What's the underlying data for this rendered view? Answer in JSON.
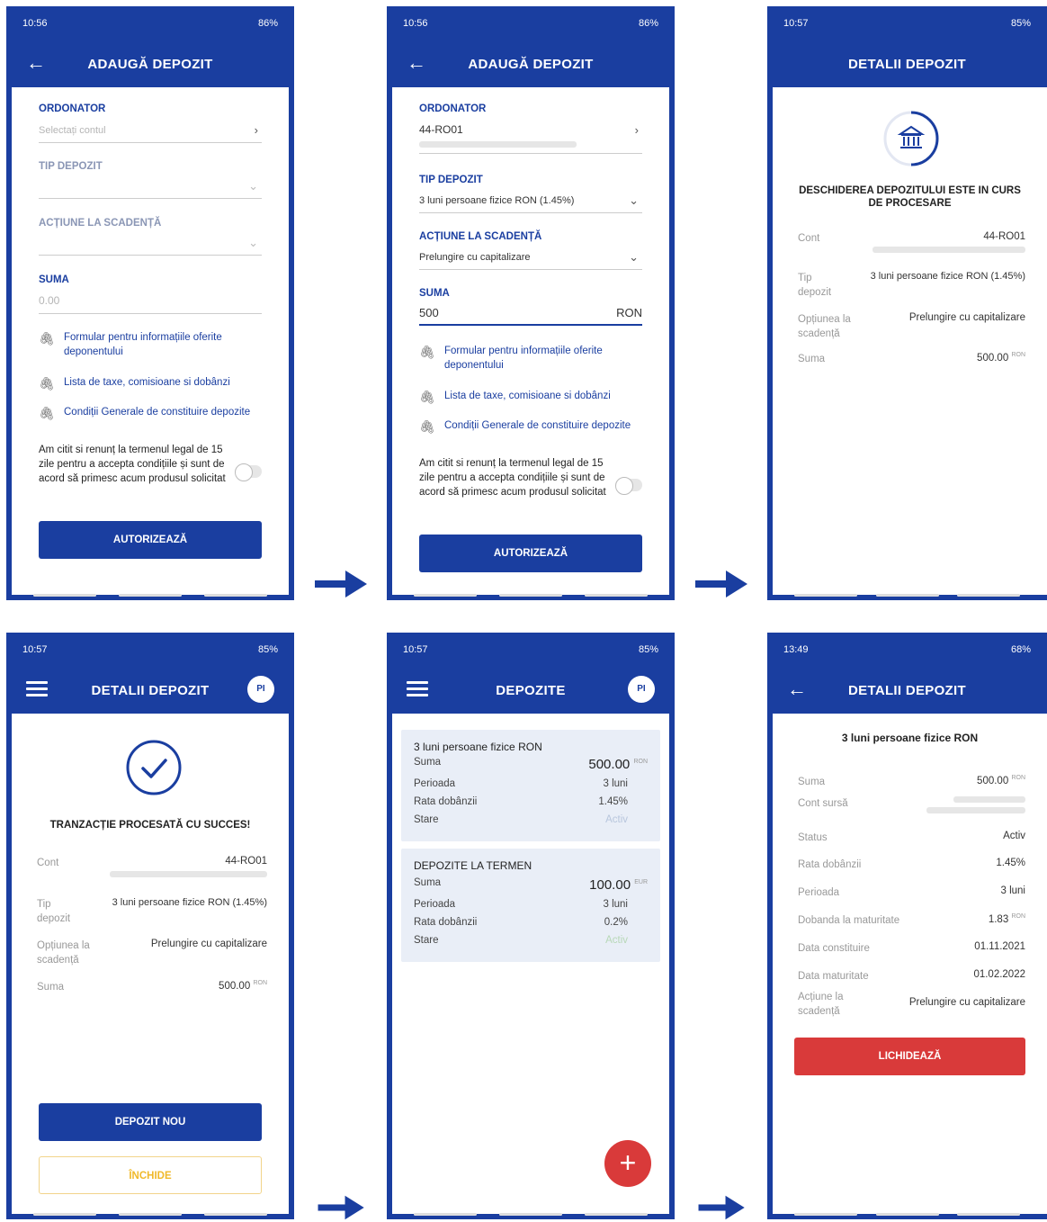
{
  "colors": {
    "brand": "#1a3ea0",
    "danger": "#d93a3a",
    "accent": "#f0b92a"
  },
  "s1": {
    "time": "10:56",
    "battery": "86%",
    "title": "ADAUGĂ DEPOZIT",
    "ordonator": "ORDONATOR",
    "ordonator_placeholder": "Selectați contul",
    "tip": "TIP DEPOZIT",
    "actiune": "ACȚIUNE LA SCADENȚĂ",
    "suma": "SUMA",
    "suma_placeholder": "0.00",
    "doc1": "Formular pentru informațiile oferite deponentului",
    "doc2": "Lista de taxe, comisioane si dobânzi",
    "doc3": "Condiții Generale de constituire depozite",
    "terms": "Am citit si renunț la termenul legal de 15 zile pentru a accepta condițiile și sunt de acord să primesc acum produsul solicitat",
    "button": "AUTORIZEAZĂ"
  },
  "s2": {
    "time": "10:56",
    "battery": "86%",
    "title": "ADAUGĂ DEPOZIT",
    "ordonator": "ORDONATOR",
    "account": "44-RO01",
    "tip": "TIP DEPOZIT",
    "tip_value": "3 luni persoane fizice RON (1.45%)",
    "actiune": "ACȚIUNE LA SCADENȚĂ",
    "actiune_value": "Prelungire cu capitalizare",
    "suma": "SUMA",
    "suma_value": "500",
    "currency": "RON",
    "doc1": "Formular pentru informațiile oferite deponentului",
    "doc2": "Lista de taxe, comisioane si dobânzi",
    "doc3": "Condiții Generale de constituire depozite",
    "terms": "Am citit si renunț la termenul legal de 15 zile pentru a accepta condițiile și sunt de acord să primesc acum produsul solicitat",
    "button": "AUTORIZEAZĂ"
  },
  "s3": {
    "time": "10:57",
    "battery": "85%",
    "title": "DETALII DEPOZIT",
    "message": "DESCHIDEREA DEPOZITULUI ESTE IN CURS DE PROCESARE",
    "k_cont": "Cont",
    "v_cont": "44-RO01",
    "k_tip": "Tip depozit",
    "v_tip": "3 luni persoane fizice RON (1.45%)",
    "k_opt": "Opțiunea la scadență",
    "v_opt": "Prelungire cu capitalizare",
    "k_suma": "Suma",
    "v_suma": "500.00",
    "v_suma_cur": "RON"
  },
  "s4": {
    "time": "10:57",
    "battery": "85%",
    "title": "DETALII DEPOZIT",
    "avatar": "PI",
    "message": "TRANZACȚIE PROCESATĂ CU SUCCES!",
    "k_cont": "Cont",
    "v_cont": "44-RO01",
    "k_tip": "Tip depozit",
    "v_tip": "3 luni persoane fizice RON (1.45%)",
    "k_opt": "Opțiunea la scadență",
    "v_opt": "Prelungire cu capitalizare",
    "k_suma": "Suma",
    "v_suma": "500.00",
    "v_suma_cur": "RON",
    "btn_new": "DEPOZIT NOU",
    "btn_close": "ÎNCHIDE"
  },
  "s5": {
    "time": "10:57",
    "battery": "85%",
    "title": "DEPOZITE",
    "avatar": "PI",
    "cards": [
      {
        "title": "3 luni persoane fizice RON",
        "k_suma": "Suma",
        "amount": "500.00",
        "cur": "RON",
        "k_per": "Perioada",
        "v_per": "3 luni",
        "k_rata": "Rata dobânzii",
        "v_rata": "1.45%",
        "k_stare": "Stare",
        "v_stare": "Activ"
      },
      {
        "title": "DEPOZITE LA TERMEN",
        "k_suma": "Suma",
        "amount": "100.00",
        "cur": "EUR",
        "k_per": "Perioada",
        "v_per": "3 luni",
        "k_rata": "Rata dobânzii",
        "v_rata": "0.2%",
        "k_stare": "Stare",
        "v_stare": "Activ"
      }
    ],
    "fab": "+"
  },
  "s6": {
    "time": "13:49",
    "battery": "68%",
    "title": "DETALII DEPOZIT",
    "heading": "3 luni persoane fizice RON",
    "k_suma": "Suma",
    "v_suma": "500.00",
    "v_suma_cur": "RON",
    "k_cont": "Cont sursă",
    "k_status": "Status",
    "v_status": "Activ",
    "k_rata": "Rata dobânzii",
    "v_rata": "1.45%",
    "k_per": "Perioada",
    "v_per": "3 luni",
    "k_dob": "Dobanda la maturitate",
    "v_dob": "1.83",
    "v_dob_cur": "RON",
    "k_const": "Data constituire",
    "v_const": "01.11.2021",
    "k_mat": "Data maturitate",
    "v_mat": "01.02.2022",
    "k_act": "Acțiune la scadență",
    "v_act": "Prelungire cu capitalizare",
    "button": "LICHIDEAZĂ"
  }
}
